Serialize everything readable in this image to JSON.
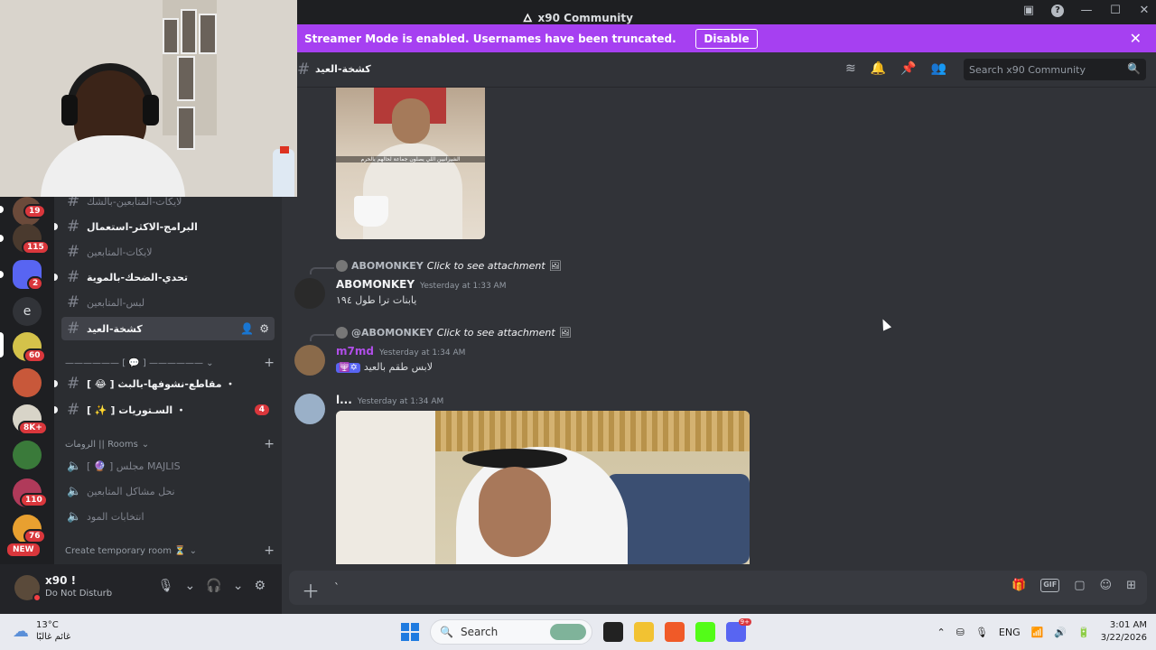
{
  "window": {
    "title": "x90 Community"
  },
  "streamer_bar": {
    "message": "Streamer Mode is enabled. Usernames have been truncated.",
    "disable_label": "Disable"
  },
  "servers": [
    {
      "badge": "19",
      "color": "#6b4a3a"
    },
    {
      "badge": "115",
      "color": "#4a3a2e"
    },
    {
      "badge": "2",
      "color": "#5865f2"
    },
    {
      "letter": "e",
      "color": "#313338"
    },
    {
      "badge": "60",
      "color": "#d4c24a"
    },
    {
      "badge": "",
      "color": "#c8583a"
    },
    {
      "badge": "8K+",
      "color": "#d8d4c8"
    },
    {
      "badge": "",
      "color": "#3a7a3a"
    },
    {
      "badge": "110",
      "color": "#b03a5a"
    },
    {
      "badge": "76",
      "color": "#e8a030"
    }
  ],
  "new_label": "NEW",
  "sidebar": {
    "channels": [
      {
        "name": "لايكات-المتابعين-بالشك",
        "muted": true
      },
      {
        "name": "البرامج-الاكثر-استعمال",
        "muted": false
      },
      {
        "name": "لايكات-المتابعين",
        "muted": true
      },
      {
        "name": "تحدي-الضحك-بالموية",
        "muted": false
      },
      {
        "name": "لبس-المتابعين",
        "muted": true
      },
      {
        "name": "كشخة-العيد",
        "muted": false,
        "active": true
      }
    ],
    "category1": "[ 💬 ]",
    "channels2": [
      {
        "name": "[ 😂 ] مقاطع-نشوفها-بالبث ・",
        "count": ""
      },
      {
        "name": "[ ✨ ] السـتوريات ・",
        "count": "4"
      }
    ],
    "rooms_category": "الرومات || Rooms",
    "voice": [
      {
        "name": "[ 🔮 ] مجلس MAJLIS"
      },
      {
        "name": "نحل مشاكل المتابعين"
      },
      {
        "name": "انتخابات المود"
      }
    ],
    "temp_room": "Create temporary room ⏳"
  },
  "user": {
    "name": "x90 !",
    "status": "Do Not Disturb"
  },
  "chat": {
    "channel": "كشخة-العيد",
    "search_placeholder": "Search x90 Community",
    "image1_caption": "الشيرانيين اللي يصلون جماعة لحالهم بالحرم",
    "messages": [
      {
        "reply_name": "ABOMONKEY",
        "reply_text": "Click to see attachment",
        "author": "ABOMONKEY",
        "author_color": "#f2f3f5",
        "time": "Yesterday at 1:33 AM",
        "text": "يابنات ترا طول ١٩٤"
      },
      {
        "reply_name": "@ABOMONKEY",
        "reply_text": "Click to see attachment",
        "author": "m7md",
        "author_color": "#b04ee8",
        "time": "Yesterday at 1:34 AM",
        "text": "لابس طقم بالعيد"
      },
      {
        "author": "l...",
        "author_color": "#f2f3f5",
        "time": "Yesterday at 1:34 AM"
      }
    ],
    "composer_value": "`"
  },
  "taskbar": {
    "temp": "13°C",
    "weather": "غائم غالبًا",
    "search_label": "Search",
    "lang": "ENG",
    "time": "3:01 AM",
    "date": "3/22/2026",
    "discord_badge": "9+"
  }
}
